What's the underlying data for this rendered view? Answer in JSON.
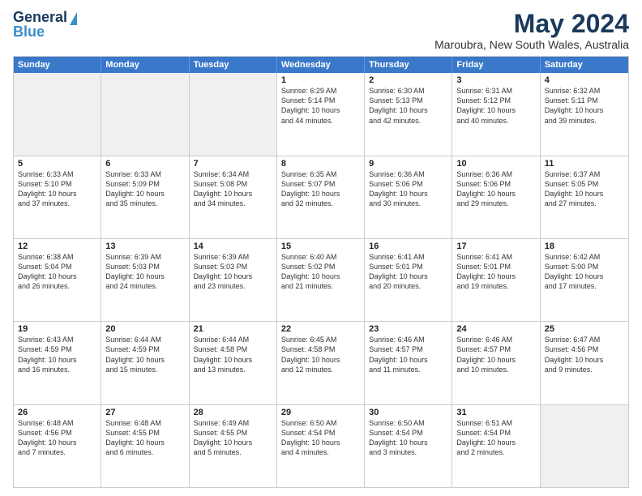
{
  "header": {
    "logo": {
      "line1": "General",
      "line2": "Blue"
    },
    "title": "May 2024",
    "subtitle": "Maroubra, New South Wales, Australia"
  },
  "calendar": {
    "days_of_week": [
      "Sunday",
      "Monday",
      "Tuesday",
      "Wednesday",
      "Thursday",
      "Friday",
      "Saturday"
    ],
    "rows": [
      [
        {
          "day": "",
          "info": "",
          "shaded": true
        },
        {
          "day": "",
          "info": "",
          "shaded": true
        },
        {
          "day": "",
          "info": "",
          "shaded": true
        },
        {
          "day": "1",
          "info": "Sunrise: 6:29 AM\nSunset: 5:14 PM\nDaylight: 10 hours\nand 44 minutes.",
          "shaded": false
        },
        {
          "day": "2",
          "info": "Sunrise: 6:30 AM\nSunset: 5:13 PM\nDaylight: 10 hours\nand 42 minutes.",
          "shaded": false
        },
        {
          "day": "3",
          "info": "Sunrise: 6:31 AM\nSunset: 5:12 PM\nDaylight: 10 hours\nand 40 minutes.",
          "shaded": false
        },
        {
          "day": "4",
          "info": "Sunrise: 6:32 AM\nSunset: 5:11 PM\nDaylight: 10 hours\nand 39 minutes.",
          "shaded": false
        }
      ],
      [
        {
          "day": "5",
          "info": "Sunrise: 6:33 AM\nSunset: 5:10 PM\nDaylight: 10 hours\nand 37 minutes.",
          "shaded": false
        },
        {
          "day": "6",
          "info": "Sunrise: 6:33 AM\nSunset: 5:09 PM\nDaylight: 10 hours\nand 35 minutes.",
          "shaded": false
        },
        {
          "day": "7",
          "info": "Sunrise: 6:34 AM\nSunset: 5:08 PM\nDaylight: 10 hours\nand 34 minutes.",
          "shaded": false
        },
        {
          "day": "8",
          "info": "Sunrise: 6:35 AM\nSunset: 5:07 PM\nDaylight: 10 hours\nand 32 minutes.",
          "shaded": false
        },
        {
          "day": "9",
          "info": "Sunrise: 6:36 AM\nSunset: 5:06 PM\nDaylight: 10 hours\nand 30 minutes.",
          "shaded": false
        },
        {
          "day": "10",
          "info": "Sunrise: 6:36 AM\nSunset: 5:06 PM\nDaylight: 10 hours\nand 29 minutes.",
          "shaded": false
        },
        {
          "day": "11",
          "info": "Sunrise: 6:37 AM\nSunset: 5:05 PM\nDaylight: 10 hours\nand 27 minutes.",
          "shaded": false
        }
      ],
      [
        {
          "day": "12",
          "info": "Sunrise: 6:38 AM\nSunset: 5:04 PM\nDaylight: 10 hours\nand 26 minutes.",
          "shaded": false
        },
        {
          "day": "13",
          "info": "Sunrise: 6:39 AM\nSunset: 5:03 PM\nDaylight: 10 hours\nand 24 minutes.",
          "shaded": false
        },
        {
          "day": "14",
          "info": "Sunrise: 6:39 AM\nSunset: 5:03 PM\nDaylight: 10 hours\nand 23 minutes.",
          "shaded": false
        },
        {
          "day": "15",
          "info": "Sunrise: 6:40 AM\nSunset: 5:02 PM\nDaylight: 10 hours\nand 21 minutes.",
          "shaded": false
        },
        {
          "day": "16",
          "info": "Sunrise: 6:41 AM\nSunset: 5:01 PM\nDaylight: 10 hours\nand 20 minutes.",
          "shaded": false
        },
        {
          "day": "17",
          "info": "Sunrise: 6:41 AM\nSunset: 5:01 PM\nDaylight: 10 hours\nand 19 minutes.",
          "shaded": false
        },
        {
          "day": "18",
          "info": "Sunrise: 6:42 AM\nSunset: 5:00 PM\nDaylight: 10 hours\nand 17 minutes.",
          "shaded": false
        }
      ],
      [
        {
          "day": "19",
          "info": "Sunrise: 6:43 AM\nSunset: 4:59 PM\nDaylight: 10 hours\nand 16 minutes.",
          "shaded": false
        },
        {
          "day": "20",
          "info": "Sunrise: 6:44 AM\nSunset: 4:59 PM\nDaylight: 10 hours\nand 15 minutes.",
          "shaded": false
        },
        {
          "day": "21",
          "info": "Sunrise: 6:44 AM\nSunset: 4:58 PM\nDaylight: 10 hours\nand 13 minutes.",
          "shaded": false
        },
        {
          "day": "22",
          "info": "Sunrise: 6:45 AM\nSunset: 4:58 PM\nDaylight: 10 hours\nand 12 minutes.",
          "shaded": false
        },
        {
          "day": "23",
          "info": "Sunrise: 6:46 AM\nSunset: 4:57 PM\nDaylight: 10 hours\nand 11 minutes.",
          "shaded": false
        },
        {
          "day": "24",
          "info": "Sunrise: 6:46 AM\nSunset: 4:57 PM\nDaylight: 10 hours\nand 10 minutes.",
          "shaded": false
        },
        {
          "day": "25",
          "info": "Sunrise: 6:47 AM\nSunset: 4:56 PM\nDaylight: 10 hours\nand 9 minutes.",
          "shaded": false
        }
      ],
      [
        {
          "day": "26",
          "info": "Sunrise: 6:48 AM\nSunset: 4:56 PM\nDaylight: 10 hours\nand 7 minutes.",
          "shaded": false
        },
        {
          "day": "27",
          "info": "Sunrise: 6:48 AM\nSunset: 4:55 PM\nDaylight: 10 hours\nand 6 minutes.",
          "shaded": false
        },
        {
          "day": "28",
          "info": "Sunrise: 6:49 AM\nSunset: 4:55 PM\nDaylight: 10 hours\nand 5 minutes.",
          "shaded": false
        },
        {
          "day": "29",
          "info": "Sunrise: 6:50 AM\nSunset: 4:54 PM\nDaylight: 10 hours\nand 4 minutes.",
          "shaded": false
        },
        {
          "day": "30",
          "info": "Sunrise: 6:50 AM\nSunset: 4:54 PM\nDaylight: 10 hours\nand 3 minutes.",
          "shaded": false
        },
        {
          "day": "31",
          "info": "Sunrise: 6:51 AM\nSunset: 4:54 PM\nDaylight: 10 hours\nand 2 minutes.",
          "shaded": false
        },
        {
          "day": "",
          "info": "",
          "shaded": true
        }
      ]
    ]
  }
}
